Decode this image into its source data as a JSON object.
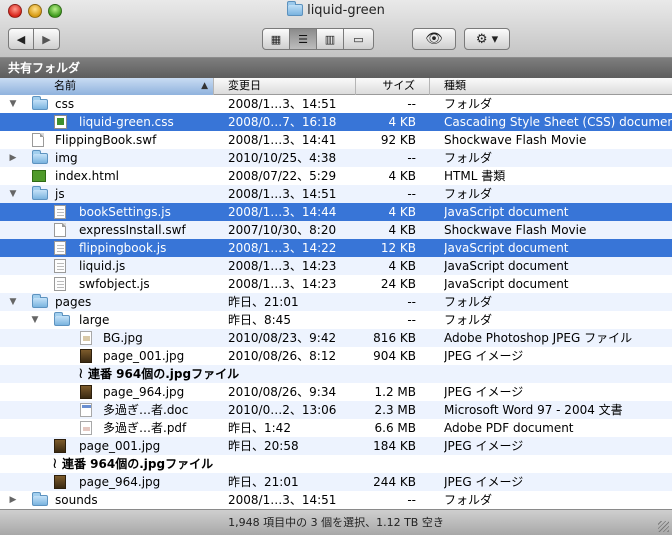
{
  "window": {
    "title": "liquid-green",
    "title_icon": "folder-icon"
  },
  "toolbar": {
    "back_glyph": "◀",
    "forward_glyph": "▶",
    "view_icon_glyph": "▦",
    "view_list_glyph": "☰",
    "view_column_glyph": "▥",
    "view_cover_glyph": "▭",
    "quicklook_glyph": "👁",
    "action_glyph": "⚙ ▾",
    "active_view": "list"
  },
  "pathbar": {
    "label": "共有フォルダ"
  },
  "columns": {
    "name": "名前",
    "date": "変更日",
    "size": "サイズ",
    "kind": "種類",
    "sort_glyph": "▲"
  },
  "rows": [
    {
      "type": "folder",
      "indent": 0,
      "tri": "▼",
      "icon": "folder-icon",
      "name": "css",
      "date": "2008/1…3、14:51",
      "size": "--",
      "kind": "フォルダ",
      "selected": false
    },
    {
      "type": "css",
      "indent": 1,
      "tri": "",
      "icon": "css-file-icon",
      "name": "liquid-green.css",
      "date": "2008/0…7、16:18",
      "size": "4 KB",
      "kind": "Cascading Style Sheet (CSS) document",
      "selected": true
    },
    {
      "type": "doc",
      "indent": 0,
      "tri": "",
      "icon": "swf-file-icon",
      "name": "FlippingBook.swf",
      "date": "2008/1…3、14:41",
      "size": "92 KB",
      "kind": "Shockwave Flash Movie",
      "selected": false
    },
    {
      "type": "folder",
      "indent": 0,
      "tri": "▶",
      "icon": "folder-icon",
      "name": "img",
      "date": "2010/10/25、4:38",
      "size": "--",
      "kind": "フォルダ",
      "selected": false
    },
    {
      "type": "html",
      "indent": 0,
      "tri": "",
      "icon": "html-file-icon",
      "name": "index.html",
      "date": "2008/07/22、5:29",
      "size": "4 KB",
      "kind": "HTML 書類",
      "selected": false
    },
    {
      "type": "folder",
      "indent": 0,
      "tri": "▼",
      "icon": "folder-icon",
      "name": "js",
      "date": "2008/1…3、14:51",
      "size": "--",
      "kind": "フォルダ",
      "selected": false
    },
    {
      "type": "js",
      "indent": 1,
      "tri": "",
      "icon": "js-file-icon",
      "name": "bookSettings.js",
      "date": "2008/1…3、14:44",
      "size": "4 KB",
      "kind": "JavaScript document",
      "selected": true
    },
    {
      "type": "doc",
      "indent": 1,
      "tri": "",
      "icon": "swf-file-icon",
      "name": "expressInstall.swf",
      "date": "2007/10/30、8:20",
      "size": "4 KB",
      "kind": "Shockwave Flash Movie",
      "selected": false
    },
    {
      "type": "js",
      "indent": 1,
      "tri": "",
      "icon": "js-file-icon",
      "name": "flippingbook.js",
      "date": "2008/1…3、14:22",
      "size": "12 KB",
      "kind": "JavaScript document",
      "selected": true
    },
    {
      "type": "js",
      "indent": 1,
      "tri": "",
      "icon": "js-file-icon",
      "name": "liquid.js",
      "date": "2008/1…3、14:23",
      "size": "4 KB",
      "kind": "JavaScript document",
      "selected": false
    },
    {
      "type": "js",
      "indent": 1,
      "tri": "",
      "icon": "js-file-icon",
      "name": "swfobject.js",
      "date": "2008/1…3、14:23",
      "size": "24 KB",
      "kind": "JavaScript document",
      "selected": false
    },
    {
      "type": "folder",
      "indent": 0,
      "tri": "▼",
      "icon": "folder-icon",
      "name": "pages",
      "date": "昨日、21:01",
      "size": "--",
      "kind": "フォルダ",
      "selected": false
    },
    {
      "type": "folder",
      "indent": 1,
      "tri": "▼",
      "icon": "folder-icon",
      "name": "large",
      "date": "昨日、8:45",
      "size": "--",
      "kind": "フォルダ",
      "selected": false
    },
    {
      "type": "jpg-light",
      "indent": 2,
      "tri": "",
      "icon": "jpeg-file-icon",
      "name": "BG.jpg",
      "date": "2010/08/23、9:42",
      "size": "816 KB",
      "kind": "Adobe Photoshop JPEG ファイル",
      "selected": false
    },
    {
      "type": "jpg",
      "indent": 2,
      "tri": "",
      "icon": "jpeg-thumbnail-icon",
      "name": "page_001.jpg",
      "date": "2010/08/26、8:12",
      "size": "904 KB",
      "kind": "JPEG イメージ",
      "selected": false
    },
    {
      "type": "note",
      "indent": 2,
      "tri": "",
      "icon": "",
      "name": "連番 964個の.jpgファイル",
      "date": "",
      "size": "",
      "kind": "",
      "selected": false
    },
    {
      "type": "jpg",
      "indent": 2,
      "tri": "",
      "icon": "jpeg-thumbnail-icon",
      "name": "page_964.jpg",
      "date": "2010/08/26、9:34",
      "size": "1.2 MB",
      "kind": "JPEG イメージ",
      "selected": false
    },
    {
      "type": "word",
      "indent": 2,
      "tri": "",
      "icon": "word-file-icon",
      "name": "多過ぎ…者.doc",
      "date": "2010/0…2、13:06",
      "size": "2.3 MB",
      "kind": "Microsoft Word 97 - 2004 文書",
      "selected": false
    },
    {
      "type": "pdf",
      "indent": 2,
      "tri": "",
      "icon": "pdf-file-icon",
      "name": "多過ぎ…者.pdf",
      "date": "昨日、1:42",
      "size": "6.6 MB",
      "kind": "Adobe PDF document",
      "selected": false
    },
    {
      "type": "jpg",
      "indent": 1,
      "tri": "",
      "icon": "jpeg-thumbnail-icon",
      "name": "page_001.jpg",
      "date": "昨日、20:58",
      "size": "184 KB",
      "kind": "JPEG イメージ",
      "selected": false
    },
    {
      "type": "note",
      "indent": 1,
      "tri": "",
      "icon": "",
      "name": "連番 964個の.jpgファイル",
      "date": "",
      "size": "",
      "kind": "",
      "selected": false
    },
    {
      "type": "jpg",
      "indent": 1,
      "tri": "",
      "icon": "jpeg-thumbnail-icon",
      "name": "page_964.jpg",
      "date": "昨日、21:01",
      "size": "244 KB",
      "kind": "JPEG イメージ",
      "selected": false
    },
    {
      "type": "folder",
      "indent": 0,
      "tri": "▶",
      "icon": "folder-icon",
      "name": "sounds",
      "date": "2008/1…3、14:51",
      "size": "--",
      "kind": "フォルダ",
      "selected": false
    }
  ],
  "note_glyph": "≀",
  "status": {
    "text": "1,948 項目中の 3 個を選択、1.12 TB 空き"
  },
  "colors": {
    "selection": "#3875d7",
    "stripe": "#edf3fe",
    "pathbar": "#6b6b6b"
  }
}
